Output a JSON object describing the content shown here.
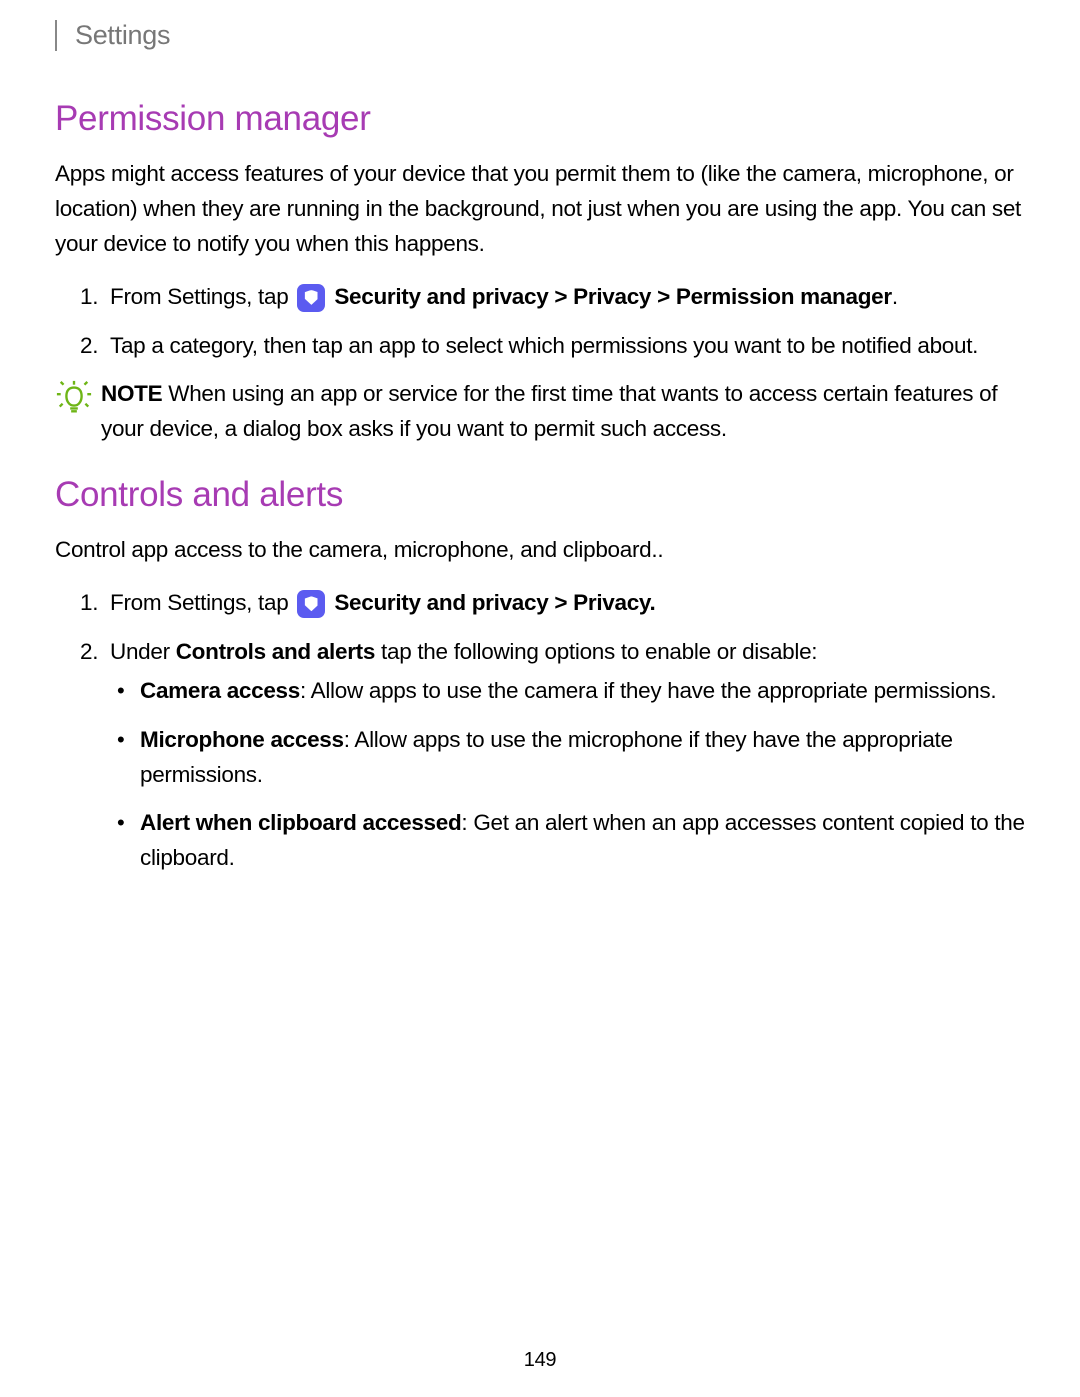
{
  "header": {
    "title": "Settings"
  },
  "sections": {
    "permission_manager": {
      "heading": "Permission manager",
      "intro": "Apps might access features of your device that you permit them to (like the camera, microphone, or location) when they are running in the background, not just when you are using the app. You can set your device to notify you when this happens.",
      "step1_prefix": "From Settings, tap ",
      "step1_bold": " Security and privacy > Privacy > Permission manager",
      "step1_suffix": ".",
      "step2": "Tap a category, then tap an app to select which permissions you want to be notified about.",
      "note_label": "NOTE",
      "note_text": "  When using an app or service for the first time that wants to access certain features of your device, a dialog box asks if you want to permit such access."
    },
    "controls_alerts": {
      "heading": "Controls and alerts",
      "intro": "Control app access to the camera, microphone, and clipboard..",
      "step1_prefix": "From Settings, tap ",
      "step1_bold": " Security and privacy > Privacy.",
      "step2_prefix": "Under ",
      "step2_bold": "Controls and alerts",
      "step2_suffix": " tap the following options to enable or disable:",
      "bullets": {
        "camera_label": "Camera access",
        "camera_text": ": Allow apps to use the camera if they have the appropriate permissions.",
        "mic_label": "Microphone access",
        "mic_text": ": Allow apps to use the microphone if they have the appropriate permissions.",
        "clip_label": "Alert when clipboard accessed",
        "clip_text": ": Get an alert when an app accesses content copied to the clipboard."
      }
    }
  },
  "page_number": "149"
}
